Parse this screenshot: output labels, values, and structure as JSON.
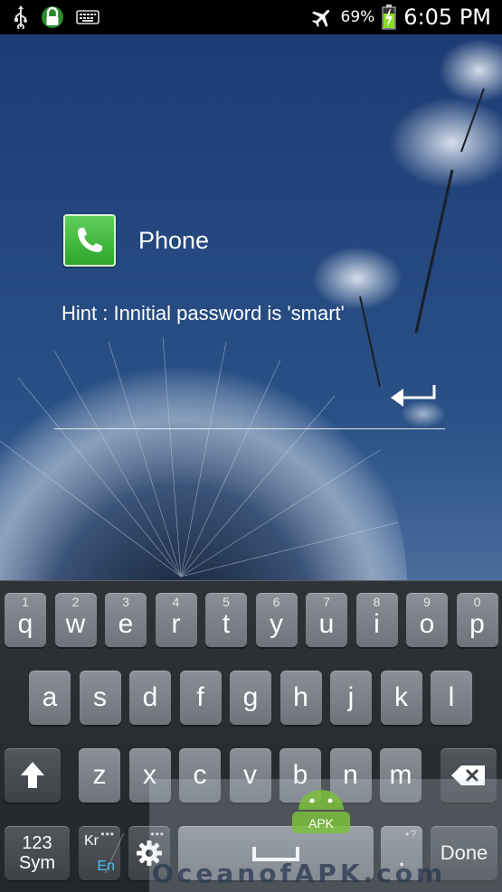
{
  "status_bar": {
    "icons_left": [
      "usb-icon",
      "lock-icon",
      "keyboard-icon"
    ],
    "icons_right": [
      "airplane-icon",
      "battery-icon"
    ],
    "battery_percent": "69%",
    "time": "6:05 PM"
  },
  "lock_screen": {
    "app_icon": "phone-icon",
    "app_name": "Phone",
    "hint": "Hint : Innitial password is 'smart'",
    "password_value": "",
    "enter_icon": "enter-arrow-icon"
  },
  "keyboard": {
    "row1": [
      {
        "label": "q",
        "hint": "1"
      },
      {
        "label": "w",
        "hint": "2"
      },
      {
        "label": "e",
        "hint": "3"
      },
      {
        "label": "r",
        "hint": "4"
      },
      {
        "label": "t",
        "hint": "5"
      },
      {
        "label": "y",
        "hint": "6"
      },
      {
        "label": "u",
        "hint": "7"
      },
      {
        "label": "i",
        "hint": "8"
      },
      {
        "label": "o",
        "hint": "9"
      },
      {
        "label": "p",
        "hint": "0"
      }
    ],
    "row2": [
      "a",
      "s",
      "d",
      "f",
      "g",
      "h",
      "j",
      "k",
      "l"
    ],
    "row3": [
      "z",
      "x",
      "c",
      "v",
      "b",
      "n",
      "m"
    ],
    "shift_icon": "shift-icon",
    "backspace_icon": "backspace-icon",
    "sym_line1": "123",
    "sym_line2": "Sym",
    "lang_kr": "Kr",
    "lang_en": "En",
    "settings_icon": "gear-icon",
    "space_icon": "space-icon",
    "dot_label": ".",
    "dot_hint": "?",
    "done_label": "Done",
    "lang_color": "#41c4f0"
  },
  "watermark": {
    "text": "OceanofAPK.com",
    "badge": "APK"
  }
}
